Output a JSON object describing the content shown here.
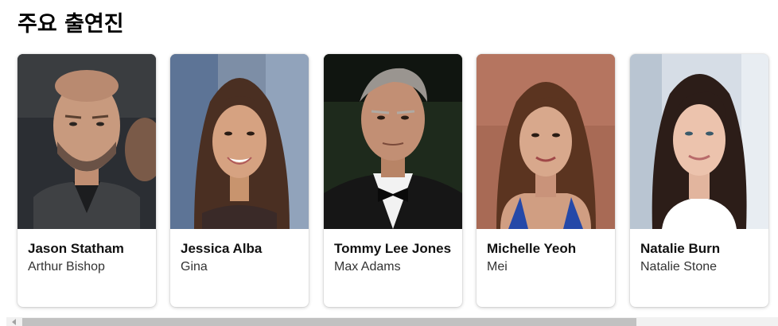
{
  "section": {
    "title": "주요 출연진"
  },
  "cast": [
    {
      "actor": "Jason Statham",
      "role": "Arthur Bishop"
    },
    {
      "actor": "Jessica Alba",
      "role": "Gina"
    },
    {
      "actor": "Tommy Lee Jones",
      "role": "Max Adams"
    },
    {
      "actor": "Michelle Yeoh",
      "role": "Mei"
    },
    {
      "actor": "Natalie Burn",
      "role": "Natalie Stone"
    }
  ],
  "colors": {
    "card_shadow": "#d0d0d0",
    "scroll_track": "#f1f1f1",
    "scroll_thumb": "#c1c1c1"
  }
}
